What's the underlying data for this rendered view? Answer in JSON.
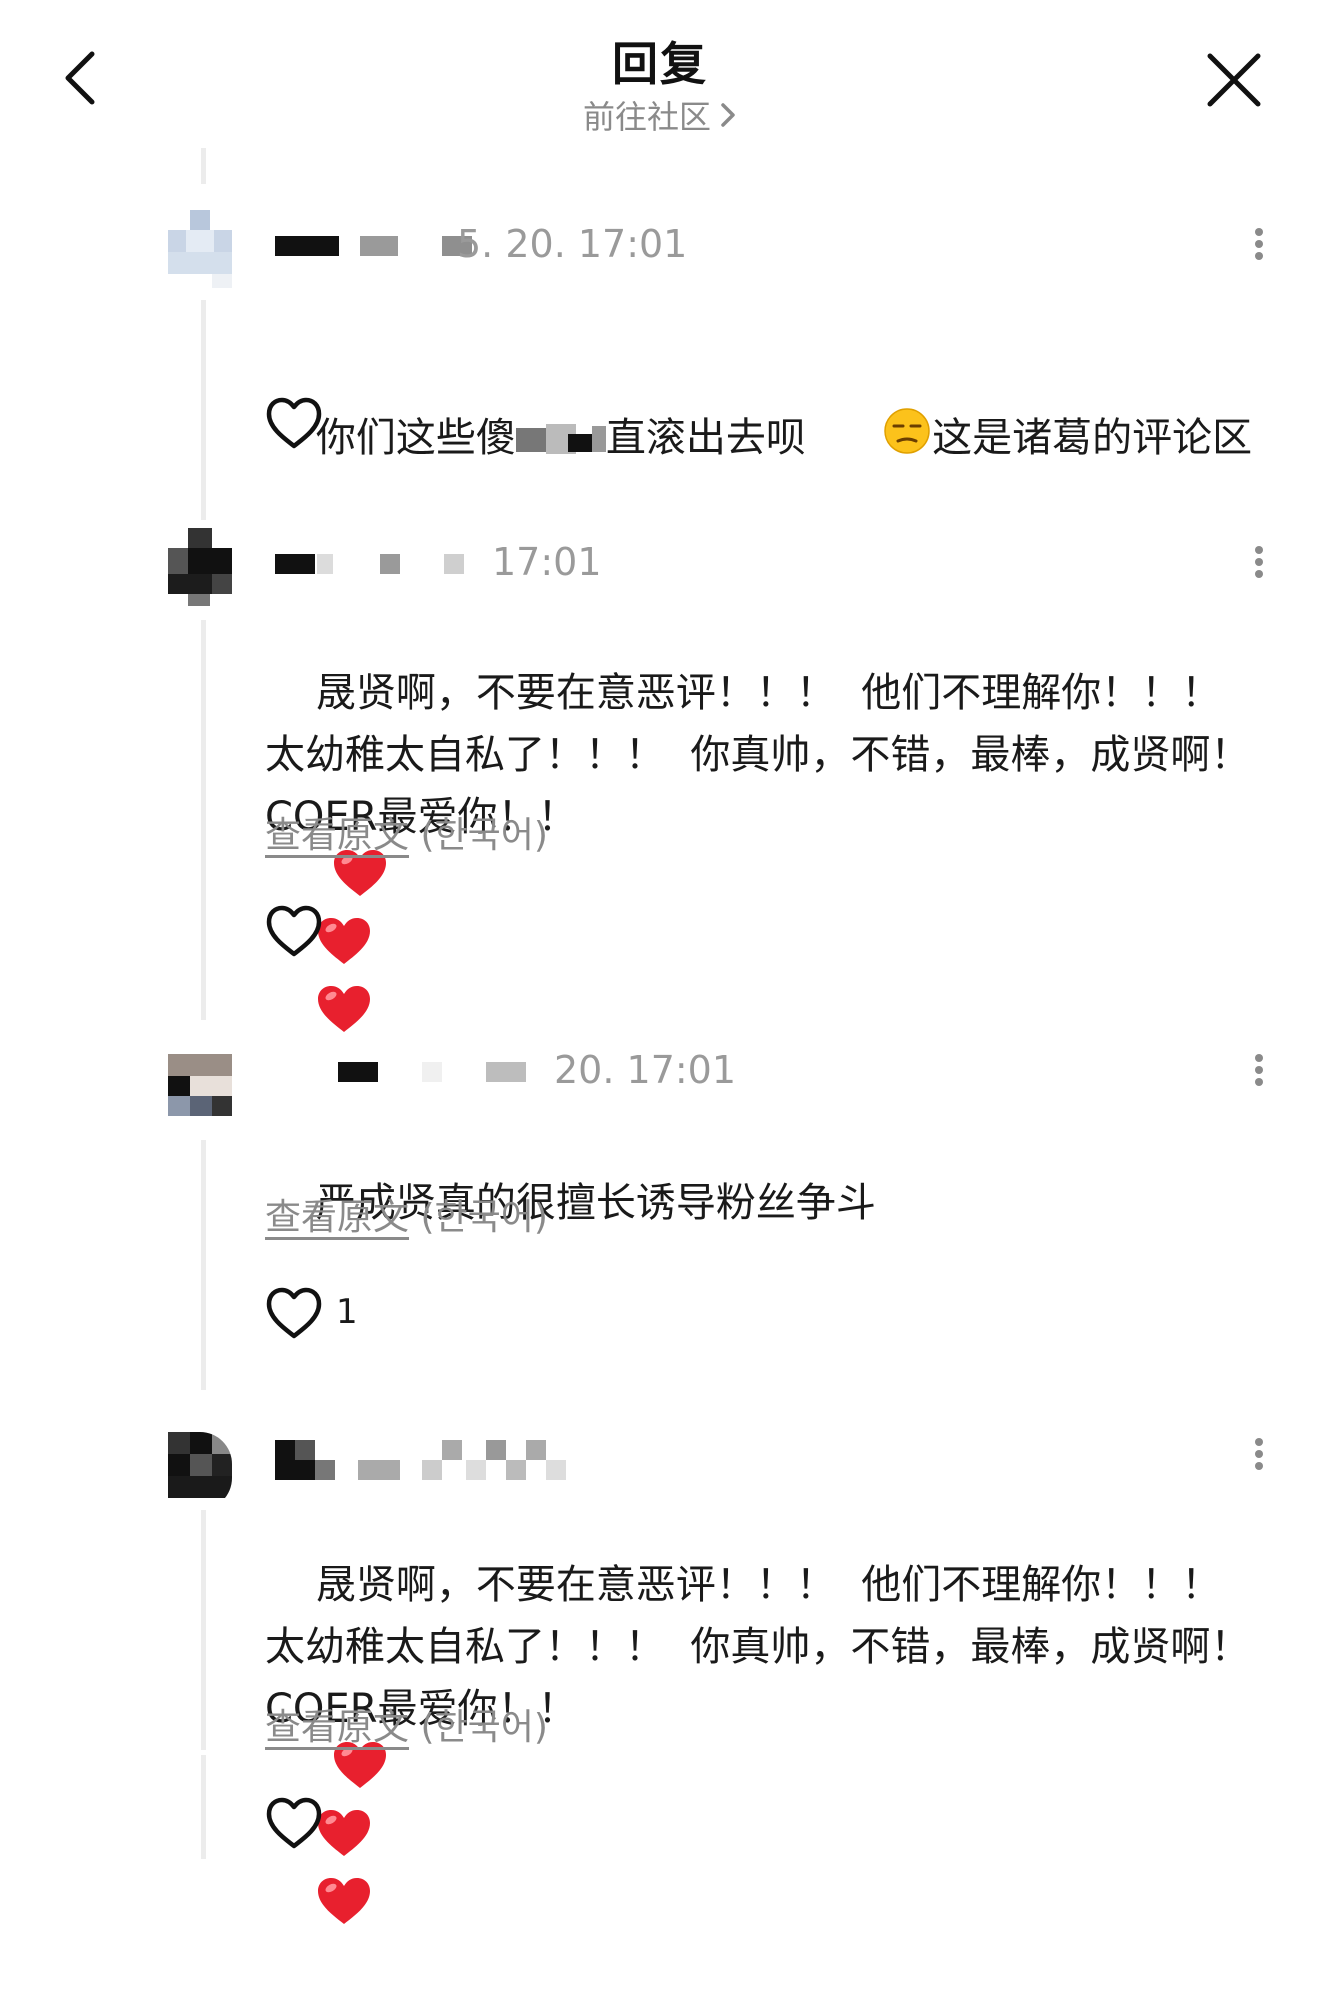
{
  "header": {
    "title": "回复",
    "community_link": "前往社区"
  },
  "colors": {
    "accent_text": "#1a1a1a",
    "muted_text": "#8a8a8a",
    "heart_red": "#e8202e"
  },
  "comments": [
    {
      "time": "5. 20. 17:01",
      "text_part1": "你们这些傻",
      "text_part2": "直滚出去呗",
      "text_part3": "这是诸葛的评论区",
      "emoji": "unamused-face-emoji",
      "likes": ""
    },
    {
      "time": "17:01",
      "text": "晟贤啊，不要在意恶评！！！  他们不理解你！！！  太幼稚太自私了！！！  你真帅，不错，最棒，成贤啊！COER最爱你！！",
      "hearts": 3,
      "translate_link": "查看原文",
      "translate_lang": "(한국어)",
      "likes": ""
    },
    {
      "time": "20. 17:01",
      "text": "严成贤真的很擅长诱导粉丝争斗",
      "translate_link": "查看原文",
      "translate_lang": "(한국어)",
      "likes": "1"
    },
    {
      "time": "",
      "text": "晟贤啊，不要在意恶评！！！  他们不理解你！！！  太幼稚太自私了！！！  你真帅，不错，最棒，成贤啊！COER最爱你！！",
      "hearts": 3,
      "translate_link": "查看原文",
      "translate_lang": "(한국어)",
      "likes": ""
    }
  ]
}
